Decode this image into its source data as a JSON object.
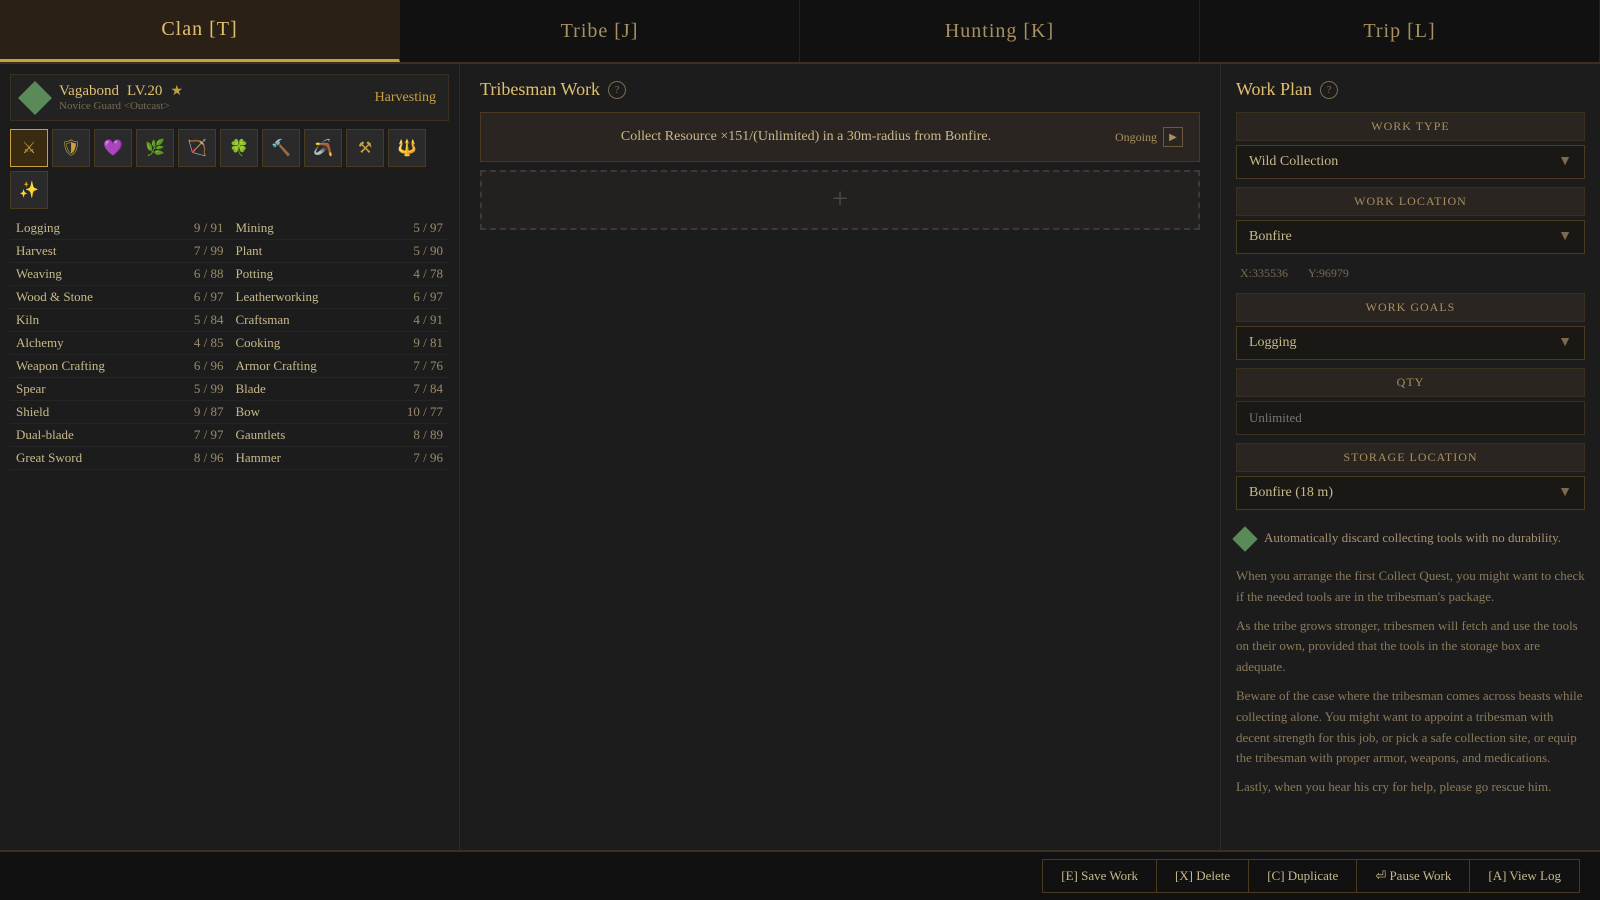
{
  "nav": {
    "tabs": [
      {
        "id": "clan",
        "label": "Clan [T]",
        "active": true
      },
      {
        "id": "tribe",
        "label": "Tribe [J]",
        "active": false
      },
      {
        "id": "hunting",
        "label": "Hunting [K]",
        "active": false
      },
      {
        "id": "trip",
        "label": "Trip [L]",
        "active": false
      }
    ]
  },
  "character": {
    "name": "Vagabond",
    "level": "LV.20",
    "subtitle": "Novice Guard <Outcast>",
    "role": "Harvesting",
    "icons": [
      "⚔",
      "🛡",
      "💜",
      "🌿",
      "🏹",
      "🍀",
      "🔨",
      "🪃",
      "⚒",
      "🔱",
      "✨"
    ]
  },
  "skills": [
    {
      "name": "Logging",
      "val": "9 / 91"
    },
    {
      "name": "Mining",
      "val": "5 / 97"
    },
    {
      "name": "Harvest",
      "val": "7 / 99"
    },
    {
      "name": "Plant",
      "val": "5 / 90"
    },
    {
      "name": "Weaving",
      "val": "6 / 88"
    },
    {
      "name": "Potting",
      "val": "4 / 78"
    },
    {
      "name": "Wood & Stone",
      "val": "6 / 97"
    },
    {
      "name": "Leatherworking",
      "val": "6 / 97"
    },
    {
      "name": "Kiln",
      "val": "5 / 84"
    },
    {
      "name": "Craftsman",
      "val": "4 / 91"
    },
    {
      "name": "Alchemy",
      "val": "4 / 85"
    },
    {
      "name": "Cooking",
      "val": "9 / 81"
    },
    {
      "name": "Weapon Crafting",
      "val": "6 / 96"
    },
    {
      "name": "Armor Crafting",
      "val": "7 / 76"
    },
    {
      "name": "Spear",
      "val": "5 / 99"
    },
    {
      "name": "Blade",
      "val": "7 / 84"
    },
    {
      "name": "Shield",
      "val": "9 / 87"
    },
    {
      "name": "Bow",
      "val": "10 / 77"
    },
    {
      "name": "Dual-blade",
      "val": "7 / 97"
    },
    {
      "name": "Gauntlets",
      "val": "8 / 89"
    },
    {
      "name": "Great Sword",
      "val": "8 / 96"
    },
    {
      "name": "Hammer",
      "val": "7 / 96"
    }
  ],
  "tribesman_work": {
    "title": "Tribesman Work",
    "task": {
      "description": "Collect Resource ×151/(Unlimited) in a 30m-radius from Bonfire.",
      "status": "Ongoing"
    },
    "add_button": "+"
  },
  "work_plan": {
    "title": "Work Plan",
    "work_type_label": "Work Type",
    "work_type_value": "Wild Collection",
    "work_location_label": "Work Location",
    "work_location_value": "Bonfire",
    "coords": {
      "x": "X:335536",
      "y": "Y:96979"
    },
    "work_goals_label": "Work Goals",
    "work_goals_value": "Logging",
    "qty_label": "Qty",
    "qty_placeholder": "Unlimited",
    "storage_label": "Storage Location",
    "storage_value": "Bonfire (18 m)",
    "auto_discard_text": "Automatically discard collecting tools with no durability.",
    "info_paragraphs": [
      "When you arrange the first Collect Quest, you might want to check if the needed tools are in the tribesman's package.",
      "As the tribe grows stronger, tribesmen will fetch and use the tools on their own, provided that the tools in the storage box are adequate.",
      "Beware of the case where the tribesman comes across beasts while collecting alone. You might want to appoint a tribesman with decent strength for this job, or pick a safe collection site, or equip the tribesman with proper armor, weapons, and medications.",
      "Lastly, when you hear his cry for help, please go rescue him."
    ]
  },
  "bottom_bar": {
    "save": "[E] Save Work",
    "delete": "[X] Delete",
    "duplicate": "[C] Duplicate",
    "pause": "⏎ Pause Work",
    "view_log": "[A] View Log"
  }
}
